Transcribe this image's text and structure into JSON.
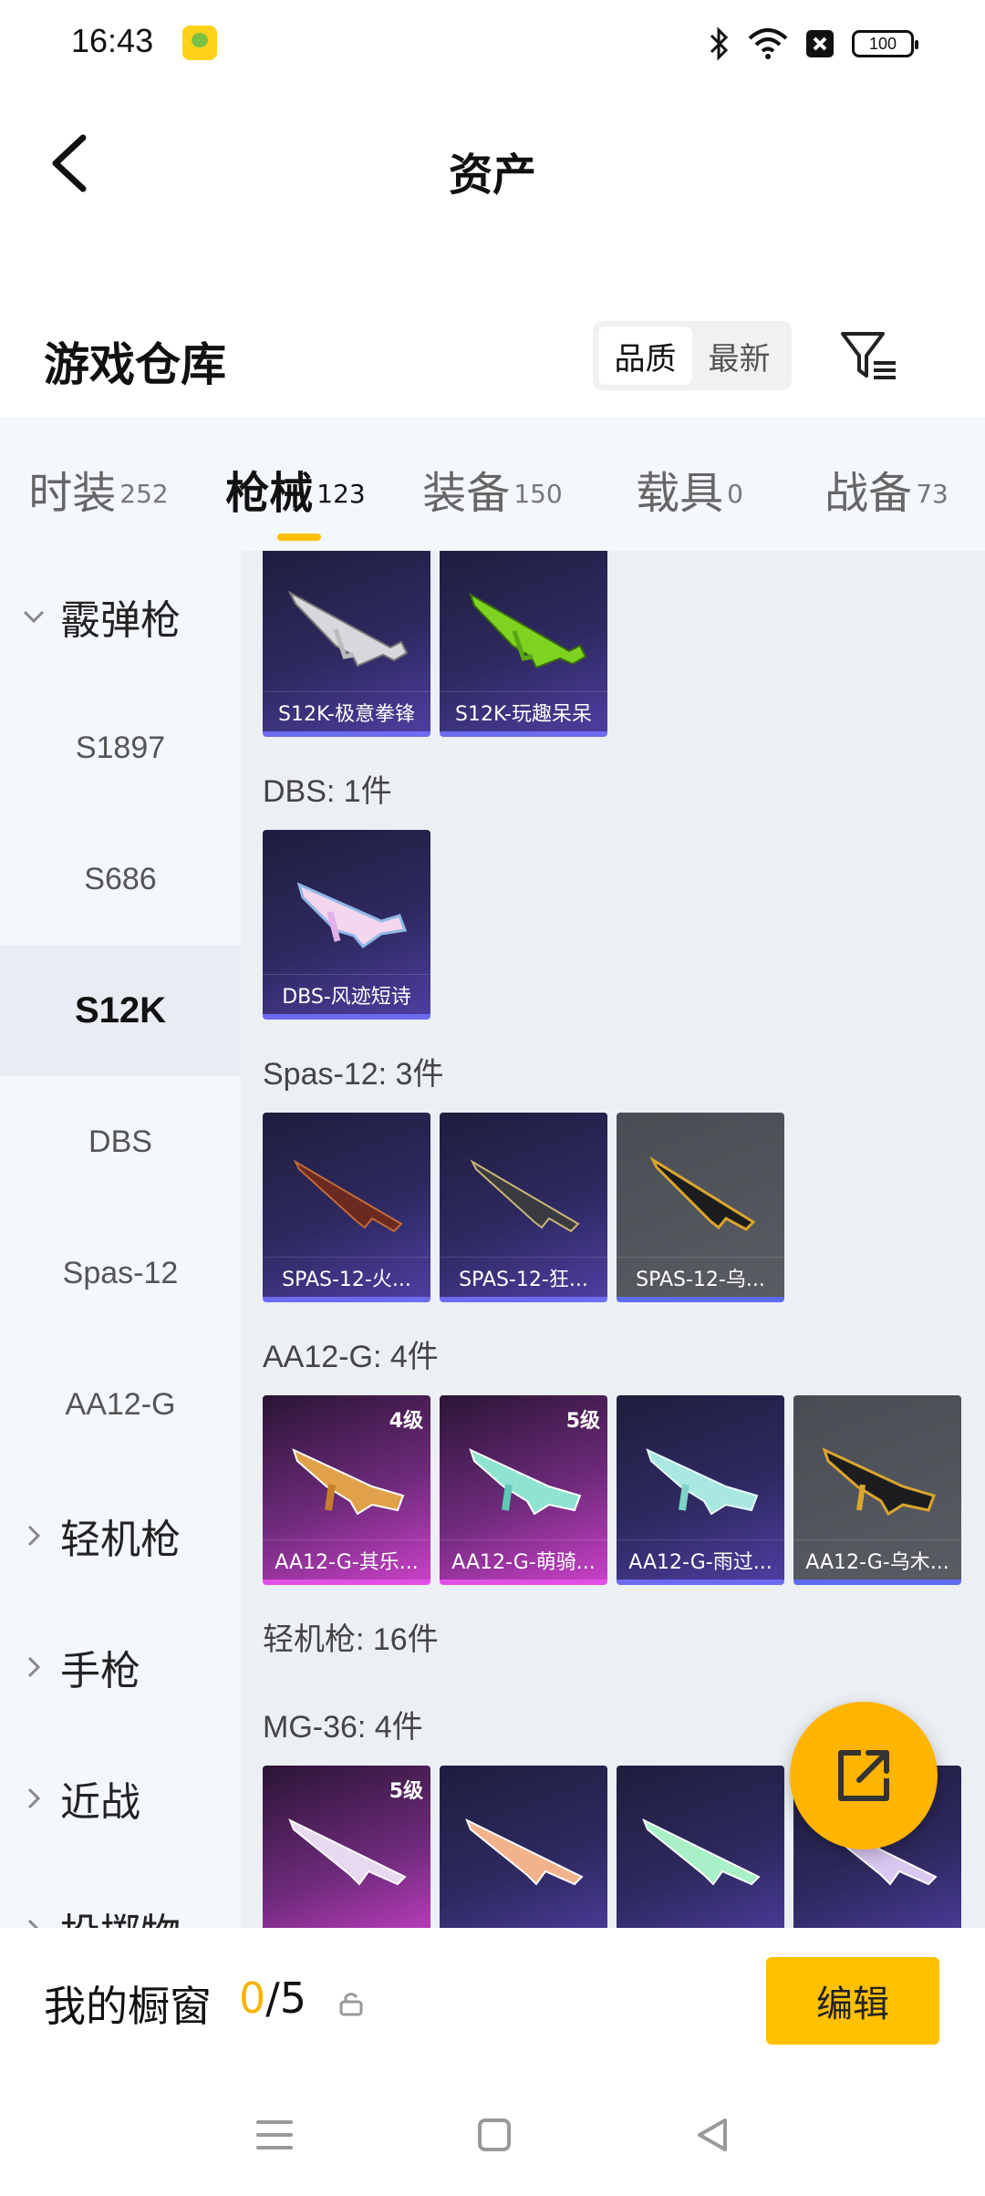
{
  "status_bar": {
    "time": "16:43",
    "battery": "100"
  },
  "header": {
    "title": "资产"
  },
  "section": {
    "title": "游戏仓库",
    "sort_options": [
      "品质",
      "最新"
    ]
  },
  "tabs": [
    {
      "label": "时装",
      "count": "252"
    },
    {
      "label": "枪械",
      "count": "123"
    },
    {
      "label": "装备",
      "count": "150"
    },
    {
      "label": "载具",
      "count": "0"
    },
    {
      "label": "战备",
      "count": "73"
    }
  ],
  "sidebar": {
    "items": [
      {
        "label": "霰弹枪"
      },
      {
        "label": "S1897"
      },
      {
        "label": "S686"
      },
      {
        "label": "S12K"
      },
      {
        "label": "DBS"
      },
      {
        "label": "Spas-12"
      },
      {
        "label": "AA12-G"
      },
      {
        "label": "轻机枪"
      },
      {
        "label": "手枪"
      },
      {
        "label": "近战"
      },
      {
        "label": "投掷物"
      }
    ]
  },
  "content": {
    "s12k_cards": [
      {
        "caption": "S12K-极意拳锋"
      },
      {
        "caption": "S12K-玩趣呆呆"
      }
    ],
    "dbs_label": "DBS: 1件",
    "dbs_cards": [
      {
        "caption": "DBS-风迹短诗"
      }
    ],
    "spas_label": "Spas-12: 3件",
    "spas_cards": [
      {
        "caption": "SPAS-12-火..."
      },
      {
        "caption": "SPAS-12-狂..."
      },
      {
        "caption": "SPAS-12-乌..."
      }
    ],
    "aa12_label": "AA12-G: 4件",
    "aa12_cards": [
      {
        "caption": "AA12-G-其乐...",
        "level": "4级"
      },
      {
        "caption": "AA12-G-萌骑...",
        "level": "5级"
      },
      {
        "caption": "AA12-G-雨过..."
      },
      {
        "caption": "AA12-G-乌木..."
      }
    ],
    "lmg_label": "轻机枪: 16件",
    "mg36_label": "MG-36: 4件",
    "mg36_cards": [
      {
        "level": "5级"
      }
    ]
  },
  "showcase": {
    "title": "我的橱窗",
    "current": "0",
    "total": "/5",
    "edit_label": "编辑"
  }
}
